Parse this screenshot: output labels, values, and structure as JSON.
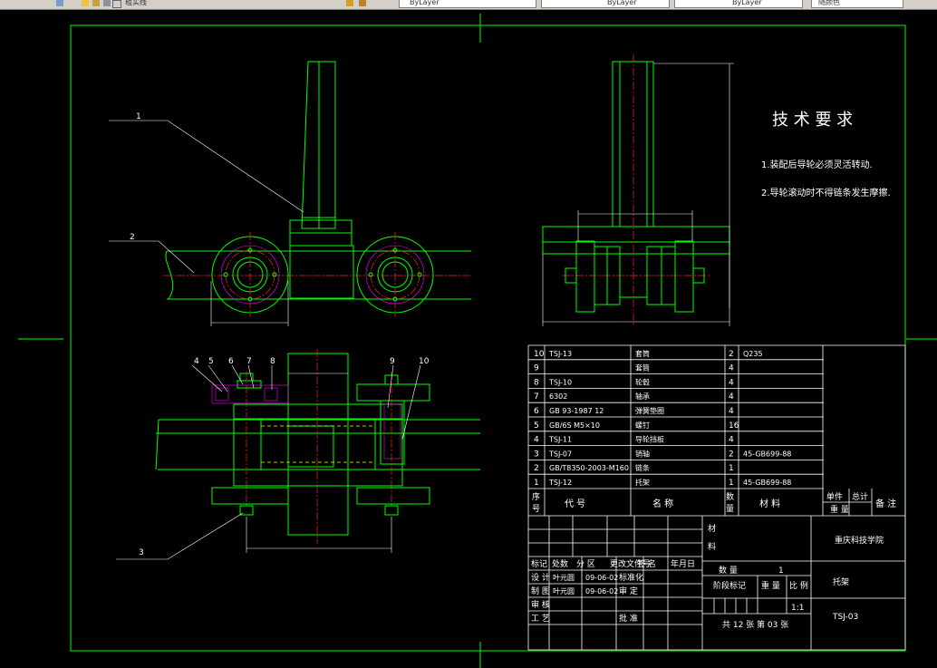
{
  "toolbar": {
    "layer_label": "粗实线",
    "color_value": "ByLayer",
    "linetype_value": "ByLayer",
    "lineweight_value": "ByLayer",
    "plotstyle_value": "随颜色"
  },
  "colors": {
    "background": "#000000",
    "outline": "#00ff00",
    "dims": "#ffffff",
    "centerline": "#ff0000",
    "hidden": "#ffff00",
    "hatch": "#ff00ff",
    "bolt": "#00ff00"
  },
  "requirements": {
    "title": "技 术 要 求",
    "items": [
      "1.装配后导轮必须灵活转动.",
      "2.导轮滚动时不得链条发生摩擦."
    ]
  },
  "balloons": [
    "1",
    "2",
    "3",
    "4",
    "5",
    "6",
    "7",
    "8",
    "9",
    "10"
  ],
  "bom": {
    "rows": [
      {
        "no": "10",
        "code": "TSJ-13",
        "name": "套筒",
        "qty": "2",
        "material": "Q235"
      },
      {
        "no": "9",
        "code": "",
        "name": "套筒",
        "qty": "4",
        "material": ""
      },
      {
        "no": "8",
        "code": "TSJ-10",
        "name": "轮毂",
        "qty": "4",
        "material": ""
      },
      {
        "no": "7",
        "code": "6302",
        "name": "轴承",
        "qty": "4",
        "material": ""
      },
      {
        "no": "6",
        "code": "GB 93-1987 12",
        "name": "弹簧垫圈",
        "qty": "4",
        "material": ""
      },
      {
        "no": "5",
        "code": "GB/6S M5×10",
        "name": "螺钉",
        "qty": "16",
        "material": ""
      },
      {
        "no": "4",
        "code": "TSJ-11",
        "name": "导轮挡板",
        "qty": "4",
        "material": ""
      },
      {
        "no": "3",
        "code": "TSJ-07",
        "name": "销轴",
        "qty": "2",
        "material": "45-GB699-88"
      },
      {
        "no": "2",
        "code": "GB/T8350-2003-M160",
        "name": "链条",
        "qty": "1",
        "material": ""
      },
      {
        "no": "1",
        "code": "TSJ-12",
        "name": "托架",
        "qty": "1",
        "material": "45-GB699-88"
      }
    ],
    "header": {
      "no": "序号",
      "code": "代 号",
      "name": "名 称",
      "qty": "数量",
      "material": "材 料",
      "unit": "单件",
      "total": "总计",
      "weight": "重 量",
      "remark": "备 注"
    }
  },
  "titleblock": {
    "material_label": "材料",
    "school": "重庆科技学院",
    "part_name": "托架",
    "drawing_no": "TSJ-03",
    "qty_label": "数 量",
    "qty_value": "1",
    "stage_label": "阶段标记",
    "weight_label": "重 量",
    "scale_label": "比 例",
    "scale_value": "1:1",
    "sheets": "共 12 张 第 03 张",
    "rev_headers": [
      "标记",
      "处数",
      "分 区",
      "更改文件号",
      "签 名",
      "年月日"
    ],
    "rows": [
      {
        "role": "设 计",
        "name": "叶元圆",
        "date": "09-06-02",
        "role2": "标准化"
      },
      {
        "role": "制 图",
        "name": "叶元圆",
        "date": "09-06-02",
        "role2": "审 定"
      },
      {
        "role": "审 核",
        "name": "",
        "date": "",
        "role2": ""
      },
      {
        "role": "工 艺",
        "name": "",
        "date": "",
        "role2": "批 准"
      }
    ]
  }
}
